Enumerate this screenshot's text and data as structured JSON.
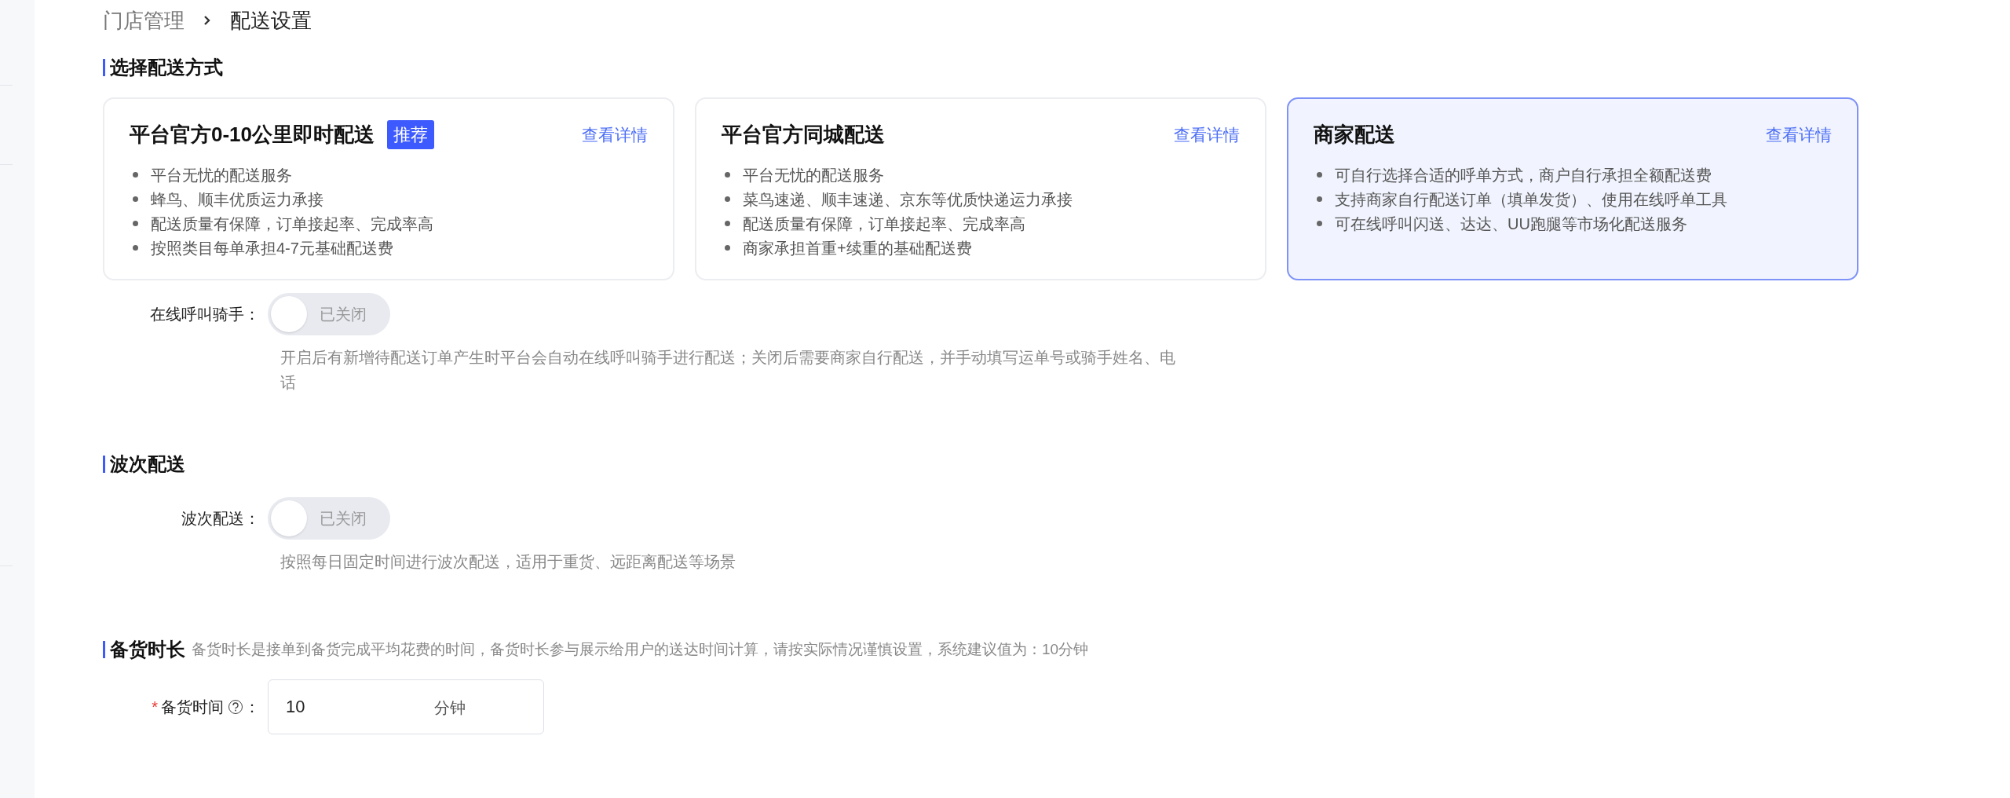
{
  "breadcrumb": [
    "门店管理",
    "配送设置"
  ],
  "delivery_section": {
    "title": "选择配送方式",
    "cards": [
      {
        "title": "平台官方0-10公里即时配送",
        "badge": "推荐",
        "link": "查看详情",
        "selected": false,
        "bullets": [
          "平台无忧的配送服务",
          "蜂鸟、顺丰优质运力承接",
          "配送质量有保障，订单接起率、完成率高",
          "按照类目每单承担4-7元基础配送费"
        ]
      },
      {
        "title": "平台官方同城配送",
        "link": "查看详情",
        "selected": false,
        "bullets": [
          "平台无忧的配送服务",
          "菜鸟速递、顺丰速递、京东等优质快递运力承接",
          "配送质量有保障，订单接起率、完成率高",
          "商家承担首重+续重的基础配送费"
        ]
      },
      {
        "title": "商家配送",
        "link": "查看详情",
        "selected": true,
        "bullets": [
          "可自行选择合适的呼单方式，商户自行承担全额配送费",
          "支持商家自行配送订单（填单发货）、使用在线呼单工具",
          "可在线呼叫闪送、达达、UU跑腿等市场化配送服务"
        ]
      }
    ],
    "switch": {
      "label": "在线呼叫骑手：",
      "on": false,
      "state_text": "已关闭",
      "description": "开启后有新增待配送订单产生时平台会自动在线呼叫骑手进行配送；关闭后需要商家自行配送，并手动填写运单号或骑手姓名、电话"
    }
  },
  "wave_section": {
    "title": "波次配送",
    "switch": {
      "label": "波次配送：",
      "on": false,
      "state_text": "已关闭",
      "description": "按照每日固定时间进行波次配送，适用于重货、远距离配送等场景"
    }
  },
  "prep_section": {
    "title": "备货时长",
    "hint": "备货时长是接单到备货完成平均花费的时间，备货时长参与展示给用户的送达时间计算，请按实际情况谨慎设置，系统建议值为：10分钟",
    "field": {
      "required_mark": "*",
      "label": "备货时间",
      "colon": "：",
      "value": "10",
      "unit": "分钟"
    }
  }
}
